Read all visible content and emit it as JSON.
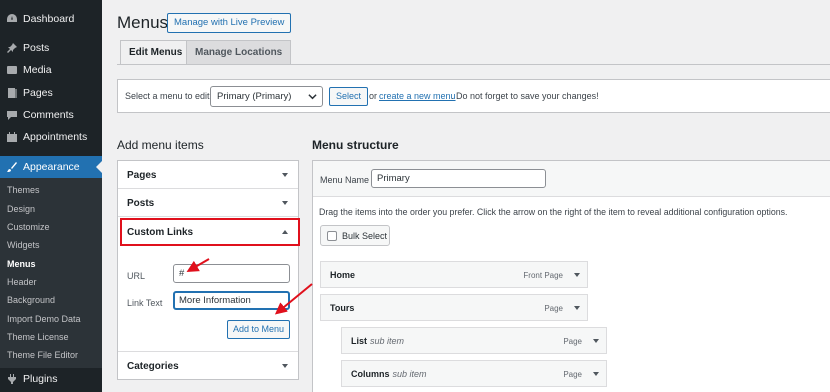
{
  "sidebar": {
    "items": [
      {
        "label": "Dashboard",
        "icon": "dashboard-icon"
      },
      {
        "label": "Posts",
        "icon": "pin-icon"
      },
      {
        "label": "Media",
        "icon": "media-icon"
      },
      {
        "label": "Pages",
        "icon": "pages-icon"
      },
      {
        "label": "Comments",
        "icon": "comment-icon"
      },
      {
        "label": "Appointments",
        "icon": "calendar-icon"
      },
      {
        "label": "Appearance",
        "icon": "paintbrush-icon",
        "active": true
      }
    ],
    "submenu": [
      "Themes",
      "Design",
      "Customize",
      "Widgets",
      "Menus",
      "Header",
      "Background",
      "Import Demo Data",
      "Theme License",
      "Theme File Editor"
    ],
    "submenu_current": "Menus",
    "plugins": {
      "label": "Plugins",
      "icon": "plugin-icon"
    }
  },
  "header": {
    "title": "Menus",
    "live_preview_label": "Manage with Live Preview"
  },
  "tabs": [
    {
      "label": "Edit Menus",
      "active": true
    },
    {
      "label": "Manage Locations",
      "active": false
    }
  ],
  "select_bar": {
    "label": "Select a menu to edit:",
    "selected": "Primary (Primary)",
    "select_button": "Select",
    "or_text": "or",
    "create_link": "create a new menu",
    "tail_text": ". Do not forget to save your changes!"
  },
  "add_items": {
    "heading": "Add menu items",
    "sections": [
      "Pages",
      "Posts",
      "Custom Links",
      "Categories"
    ],
    "custom_links": {
      "url_label": "URL",
      "url_value": "#",
      "link_text_label": "Link Text",
      "link_text_value": "More Information",
      "add_button": "Add to Menu"
    }
  },
  "structure": {
    "heading": "Menu structure",
    "menu_name_label": "Menu Name",
    "menu_name_value": "Primary",
    "instructions": "Drag the items into the order you prefer. Click the arrow on the right of the item to reveal additional configuration options.",
    "bulk_select": "Bulk Select",
    "items": [
      {
        "title": "Home",
        "sub": "",
        "type": "Front Page"
      },
      {
        "title": "Tours",
        "sub": "",
        "type": "Page"
      },
      {
        "title": "List",
        "sub": "sub item",
        "type": "Page"
      },
      {
        "title": "Columns",
        "sub": "sub item",
        "type": "Page"
      }
    ]
  },
  "colors": {
    "sidebar_bg": "#1d2327",
    "accent": "#2271b1",
    "highlight": "#e0101c"
  }
}
